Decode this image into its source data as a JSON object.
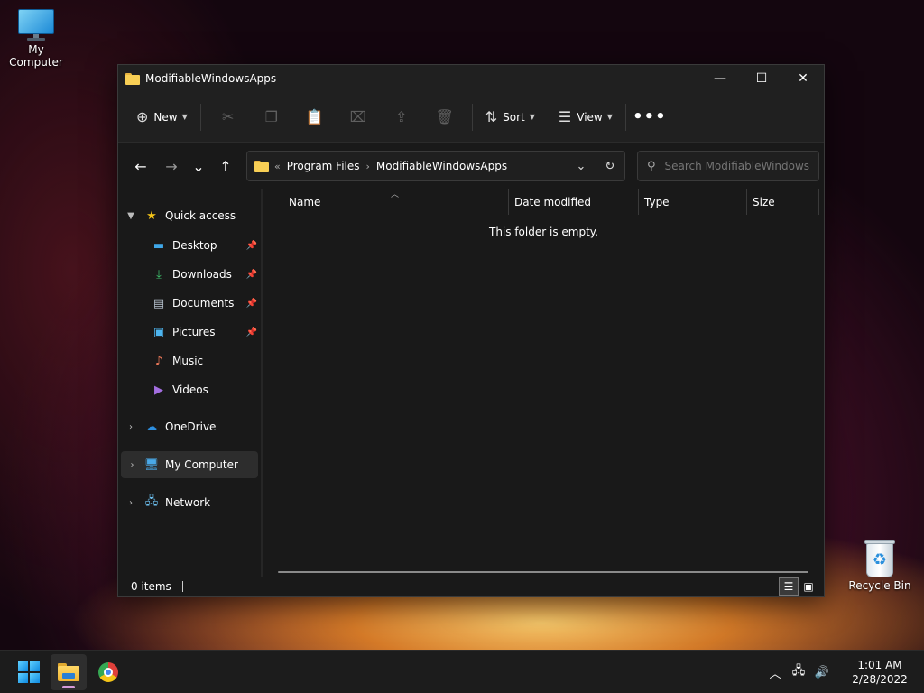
{
  "desktop": {
    "icons": [
      {
        "label": "My Computer"
      },
      {
        "label": "Recycle Bin"
      }
    ]
  },
  "window": {
    "title": "ModifiableWindowsApps",
    "controls": {
      "minimize": "—",
      "maximize": "☐",
      "close": "✕"
    }
  },
  "toolbar": {
    "new_label": "New",
    "sort_label": "Sort",
    "view_label": "View",
    "icons": [
      "cut-icon",
      "copy-icon",
      "paste-icon",
      "rename-icon",
      "share-icon",
      "delete-icon"
    ],
    "more": "•••"
  },
  "navigation": {
    "back": "←",
    "forward": "→",
    "recent": "⌄",
    "up": "↑"
  },
  "address": {
    "overflow": "«",
    "crumbs": [
      "Program Files",
      "ModifiableWindowsApps"
    ],
    "separator": "›"
  },
  "search": {
    "placeholder": "Search ModifiableWindows..."
  },
  "sidebar": {
    "quick_access": "Quick access",
    "items": [
      {
        "label": "Desktop",
        "pinned": true
      },
      {
        "label": "Downloads",
        "pinned": true
      },
      {
        "label": "Documents",
        "pinned": true
      },
      {
        "label": "Pictures",
        "pinned": true
      },
      {
        "label": "Music",
        "pinned": false
      },
      {
        "label": "Videos",
        "pinned": false
      }
    ],
    "onedrive": "OneDrive",
    "my_computer": "My Computer",
    "network": "Network"
  },
  "columns": [
    "Name",
    "Date modified",
    "Type",
    "Size"
  ],
  "content": {
    "empty_message": "This folder is empty."
  },
  "status": {
    "items": "0 items"
  },
  "taskbar": {
    "clock_time": "1:01 AM",
    "clock_date": "2/28/2022"
  },
  "colors": {
    "window_bg": "#191919",
    "accent": "#0f8ae0",
    "folder": "#f8cf55"
  }
}
